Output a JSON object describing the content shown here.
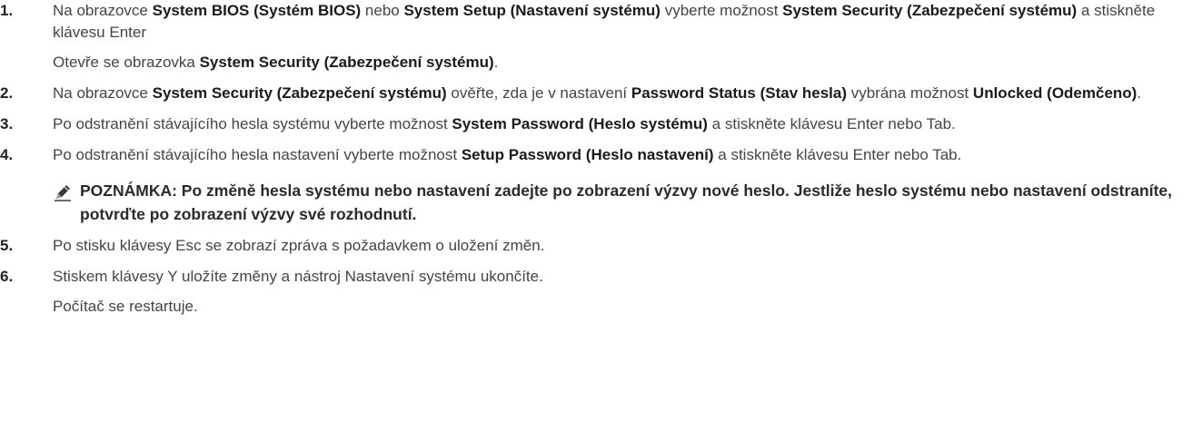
{
  "steps": [
    {
      "number": "1.",
      "parts": [
        {
          "t": "Na obrazovce "
        },
        {
          "t": "System BIOS (Systém BIOS)",
          "b": true
        },
        {
          "t": " nebo "
        },
        {
          "t": "System Setup (Nastavení systému)",
          "b": true
        },
        {
          "t": " vyberte možnost "
        },
        {
          "t": "System Security (Zabezpečení systému)",
          "b": true
        },
        {
          "t": " a stiskněte klávesu Enter"
        }
      ],
      "result": [
        {
          "t": "Otevře se obrazovka "
        },
        {
          "t": "System Security (Zabezpečení systému)",
          "b": true
        },
        {
          "t": "."
        }
      ]
    },
    {
      "number": "2.",
      "parts": [
        {
          "t": "Na obrazovce "
        },
        {
          "t": "System Security (Zabezpečení systému)",
          "b": true
        },
        {
          "t": " ověřte, zda je v nastavení "
        },
        {
          "t": "Password Status (Stav hesla)",
          "b": true
        },
        {
          "t": " vybrána možnost "
        },
        {
          "t": "Unlocked (Odemčeno)",
          "b": true
        },
        {
          "t": "."
        }
      ]
    },
    {
      "number": "3.",
      "parts": [
        {
          "t": "Po odstranění stávajícího hesla systému vyberte možnost "
        },
        {
          "t": "System Password (Heslo systému)",
          "b": true
        },
        {
          "t": " a stiskněte klávesu Enter nebo Tab."
        }
      ]
    },
    {
      "number": "4.",
      "parts": [
        {
          "t": "Po odstranění stávajícího hesla nastavení vyberte možnost "
        },
        {
          "t": "Setup Password (Heslo nastavení)",
          "b": true
        },
        {
          "t": " a stiskněte klávesu Enter nebo Tab."
        }
      ],
      "note": "POZNÁMKA: Po změně hesla systému nebo nastavení zadejte po zobrazení výzvy nové heslo. Jestliže heslo systému nebo nastavení odstraníte, potvrďte po zobrazení výzvy své rozhodnutí."
    },
    {
      "number": "5.",
      "parts": [
        {
          "t": "Po stisku klávesy Esc se zobrazí zpráva s požadavkem o uložení změn."
        }
      ]
    },
    {
      "number": "6.",
      "parts": [
        {
          "t": "Stiskem klávesy Y uložíte změny a nástroj Nastavení systému ukončíte."
        }
      ],
      "result": [
        {
          "t": "Počítač se restartuje."
        }
      ]
    }
  ],
  "note_icon": "pencil-note-icon"
}
